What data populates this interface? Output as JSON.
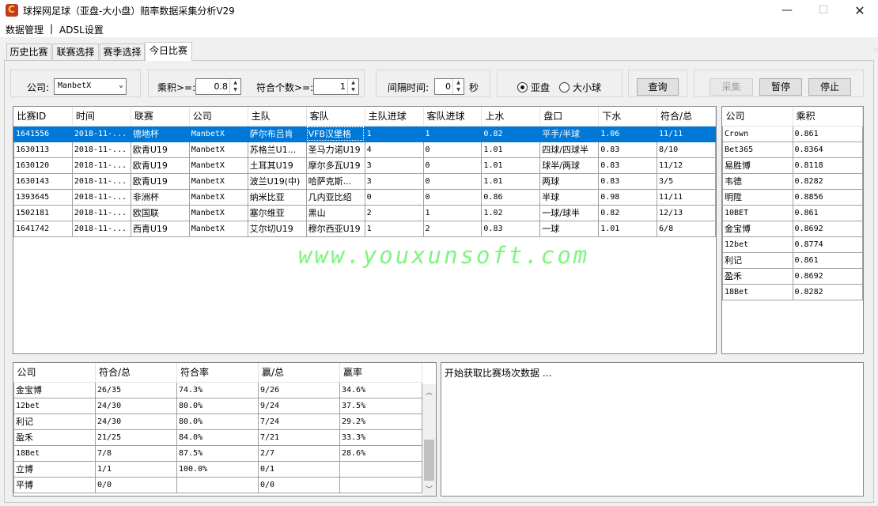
{
  "window": {
    "title": "球探网足球（亚盘-大小盘）赔率数据采集分析V29",
    "min": "—",
    "max": "☐",
    "close": "✕"
  },
  "menu": [
    "数据管理",
    "|",
    "ADSL设置"
  ],
  "tabs": [
    "历史比赛",
    "联赛选择",
    "赛季选择",
    "今日比赛"
  ],
  "filters": {
    "company_label": "公司:",
    "company_value": "ManbetX",
    "product_label": "乘积>=:",
    "product_value": "0.8",
    "match_count_label": "符合个数>=:",
    "match_count_value": "1",
    "interval_label": "间隔时间:",
    "interval_value": "0",
    "interval_unit": "秒",
    "radio_asian": "亚盘",
    "radio_ou": "大小球"
  },
  "buttons": {
    "query": "查询",
    "collect": "采集",
    "pause": "暂停",
    "stop": "停止"
  },
  "matches": {
    "headers": [
      "比赛ID",
      "时间",
      "联赛",
      "公司",
      "主队",
      "客队",
      "主队进球",
      "客队进球",
      "上水",
      "盘口",
      "下水",
      "符合/总"
    ],
    "rows": [
      [
        "1641556",
        "2018-11-...",
        "德地杯",
        "ManbetX",
        "萨尔布吕肯",
        "VFB汉堡格",
        "1",
        "1",
        "0.82",
        "平手/半球",
        "1.06",
        "11/11"
      ],
      [
        "1630113",
        "2018-11-...",
        "欧青U19",
        "ManbetX",
        "苏格兰U1...",
        "圣马力诺U19",
        "4",
        "0",
        "1.01",
        "四球/四球半",
        "0.83",
        "8/10"
      ],
      [
        "1630120",
        "2018-11-...",
        "欧青U19",
        "ManbetX",
        "土耳其U19",
        "摩尔多瓦U19",
        "3",
        "0",
        "1.01",
        "球半/两球",
        "0.83",
        "11/12"
      ],
      [
        "1630143",
        "2018-11-...",
        "欧青U19",
        "ManbetX",
        "波兰U19(中)",
        "哈萨克斯...",
        "3",
        "0",
        "1.01",
        "两球",
        "0.83",
        "3/5"
      ],
      [
        "1393645",
        "2018-11-...",
        "非洲杯",
        "ManbetX",
        "纳米比亚",
        "几内亚比绍",
        "0",
        "0",
        "0.86",
        "半球",
        "0.98",
        "11/11"
      ],
      [
        "1502181",
        "2018-11-...",
        "欧国联",
        "ManbetX",
        "塞尔维亚",
        "黑山",
        "2",
        "1",
        "1.02",
        "一球/球半",
        "0.82",
        "12/13"
      ],
      [
        "1641742",
        "2018-11-...",
        "西青U19",
        "ManbetX",
        "艾尔切U19",
        "穆尔西亚U19",
        "1",
        "2",
        "0.83",
        "一球",
        "1.01",
        "6/8"
      ]
    ]
  },
  "watermark": "www.youxunsoft.com",
  "companies": {
    "headers": [
      "公司",
      "乘积"
    ],
    "rows": [
      [
        "Crown",
        "0.861"
      ],
      [
        "Bet365",
        "0.8364"
      ],
      [
        "易胜博",
        "0.8118"
      ],
      [
        "韦德",
        "0.8282"
      ],
      [
        "明陞",
        "0.8856"
      ],
      [
        "10BET",
        "0.861"
      ],
      [
        "金宝博",
        "0.8692"
      ],
      [
        "12bet",
        "0.8774"
      ],
      [
        "利记",
        "0.861"
      ],
      [
        "盈禾",
        "0.8692"
      ],
      [
        "18Bet",
        "0.8282"
      ]
    ]
  },
  "stats": {
    "headers": [
      "公司",
      "符合/总",
      "符合率",
      "赢/总",
      "赢率"
    ],
    "rows": [
      [
        "金宝博",
        "26/35",
        "74.3%",
        "9/26",
        "34.6%"
      ],
      [
        "12bet",
        "24/30",
        "80.0%",
        "9/24",
        "37.5%"
      ],
      [
        "利记",
        "24/30",
        "80.0%",
        "7/24",
        "29.2%"
      ],
      [
        "盈禾",
        "21/25",
        "84.0%",
        "7/21",
        "33.3%"
      ],
      [
        "18Bet",
        "7/8",
        "87.5%",
        "2/7",
        "28.6%"
      ],
      [
        "立博",
        "1/1",
        "100.0%",
        "0/1",
        ""
      ],
      [
        "平博",
        "0/0",
        "",
        "0/0",
        ""
      ]
    ]
  },
  "log": {
    "text": "开始获取比赛场次数据 ..."
  },
  "colors": {
    "selection": "#0078d7",
    "watermark": "#7ff57f"
  }
}
